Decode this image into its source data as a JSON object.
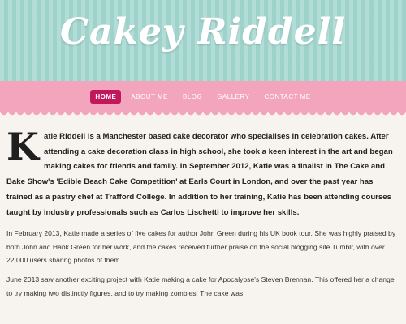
{
  "header": {
    "title": "Cakey Riddell"
  },
  "nav": {
    "items": [
      {
        "label": "HOME"
      },
      {
        "label": "ABOUT ME"
      },
      {
        "label": "BLOG"
      },
      {
        "label": "GALLERY"
      },
      {
        "label": "CONTACT ME"
      }
    ]
  },
  "content": {
    "intro_dropcap": "K",
    "intro_rest": "atie Riddell is a Manchester based cake decorator who specialises in celebration cakes. After attending a cake decoration class in high school, she took a keen interest in the art and began making cakes for friends and family. In September 2012, Katie was a finalist in The Cake and Bake Show's 'Edible Beach Cake Competition' at Earls Court in London, and over the past year has trained as a pastry chef at Trafford College. In addition to her training, Katie has been attending courses taught by industry professionals such as Carlos Lischetti to improve her skills.",
    "para2": "In February 2013, Katie made a series of five cakes for author John Green during his UK book tour. She was highly praised by both John and Hank Green for her work, and the cakes received further praise on the social blogging site Tumblr, with over 22,000 users sharing photos of them.",
    "para3": "June 2013 saw another exciting project with Katie making a cake for Apocalypse's Steven Brennan. This offered her a change to try making two distinctly figures, and to try making zombies! The cake was"
  },
  "colors": {
    "header_bg": "#9ed3cc",
    "nav_bg": "#f4a5be",
    "nav_active": "#c2185b",
    "page_bg": "#f7f4ef"
  }
}
